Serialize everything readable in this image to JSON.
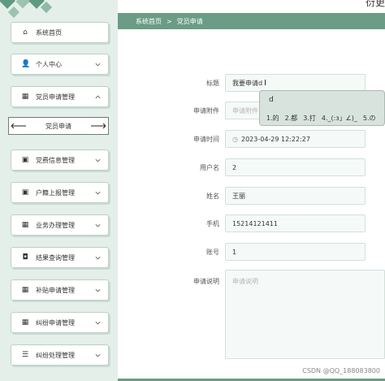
{
  "header": {
    "top_title": "衍更"
  },
  "breadcrumb": {
    "home": "系统首页",
    "separator": ">",
    "current": "党员申请"
  },
  "sidebar": {
    "items": [
      {
        "label": "系统首页",
        "icon": "home-icon",
        "glyph": "⌂"
      },
      {
        "label": "个人中心",
        "icon": "user-icon",
        "glyph": "👤"
      },
      {
        "label": "党员申请管理",
        "icon": "grid-icon",
        "glyph": "▦"
      },
      {
        "label": "党费信息管理",
        "icon": "clipboard-icon",
        "glyph": "▣"
      },
      {
        "label": "户籍上报管理",
        "icon": "clipboard-icon",
        "glyph": "▣"
      },
      {
        "label": "业务办理管理",
        "icon": "grid-icon",
        "glyph": "▦"
      },
      {
        "label": "结果查询管理",
        "icon": "ticket-icon",
        "glyph": "◘"
      },
      {
        "label": "补贴申请管理",
        "icon": "grid-icon",
        "glyph": "▦"
      },
      {
        "label": "纠纷申请管理",
        "icon": "grid-icon",
        "glyph": "▦"
      },
      {
        "label": "纠纷处理管理",
        "icon": "list-icon",
        "glyph": "☰"
      }
    ],
    "subitem": {
      "label": "党员申请"
    }
  },
  "form": {
    "title": {
      "label": "标题",
      "value": "我要申请d"
    },
    "attachment": {
      "label": "申请附件",
      "placeholder": "申请附件"
    },
    "time": {
      "label": "申请时间",
      "value": "2023-04-29 12:22:27",
      "icon": "clock-icon",
      "glyph": "◷"
    },
    "username": {
      "label": "用户名",
      "value": "2"
    },
    "name": {
      "label": "姓名",
      "value": "王丽"
    },
    "phone": {
      "label": "手机",
      "value": "15214121411"
    },
    "account": {
      "label": "账号",
      "value": "1"
    },
    "description": {
      "label": "申请说明",
      "placeholder": "申请说明"
    }
  },
  "ime": {
    "composition": "d",
    "candidates": [
      "1.的",
      "2.都",
      "3.打",
      "4._(:з」∠)_",
      "5.の"
    ]
  },
  "watermark": "CSDN @QQ_188083800",
  "colors": {
    "accent": "#6a9c86",
    "sidebar_bg": "#e4efe9"
  }
}
